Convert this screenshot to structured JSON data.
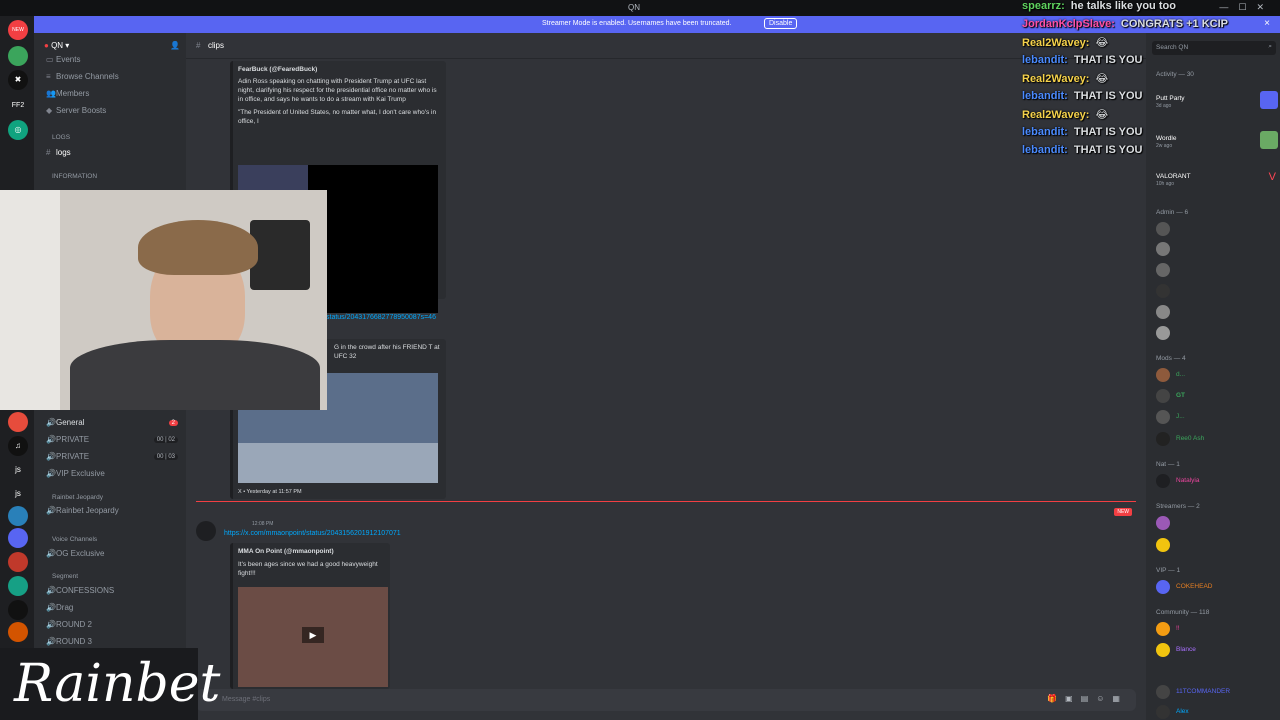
{
  "titlebar": {
    "title": "QN"
  },
  "banner": {
    "message": "Streamer Mode is enabled. Usernames have been truncated.",
    "button": "Disable",
    "close": "×"
  },
  "servers": [
    {
      "label": "NEW",
      "color": "#f23f43"
    },
    {
      "label": "FF2",
      "color": "#1e1f22"
    }
  ],
  "server": {
    "name": "QN"
  },
  "channels": {
    "top": [
      "Events",
      "Browse Channels",
      "Members",
      "Server Boosts"
    ],
    "cat_logs": "LOGS",
    "logs": "logs",
    "cat_info": "INFORMATION",
    "general": "General",
    "general_badge": "2",
    "private1": "PRIVATE",
    "private1_pill": "00 | 02",
    "private2": "PRIVATE",
    "private2_pill": "00 | 03",
    "vip": "VIP Exclusive",
    "cat_jeopardy": "Rainbet Jeopardy",
    "jeopardy": "Rainbet Jeopardy",
    "cat_voice": "Voice Channels",
    "og": "OG Exclusive",
    "cat_segment": "Segment",
    "confessions": "CONFESSIONS",
    "drag": "Drag",
    "round2": "ROUND 2",
    "round3": "ROUND 3"
  },
  "chat": {
    "channel": "clips",
    "card1_author": "FearBuck (@FearedBuck)",
    "card1_text": "Adin Ross speaking on chatting with President Trump at UFC last night, clarifying his respect for the presidential office no matter who is in office, and says he wants to do a stream with Kai Trump",
    "card1_quote": "\"The President of United States, no matter what, I don't care who's in office, I",
    "link1": "status/2043176682778950087s=46",
    "card2_text": "G in the crowd after his FRIEND T at UFC 32",
    "card2_footer": "X • Yesterday at 11:57 PM",
    "time2": "12:08 PM",
    "link2": "https://x.com/mmaonpoint/status/2043156201912107071",
    "card3_author": "MMA On Point (@mmaonpoint)",
    "card3_text": "It's been ages since we had a good heavyweight fight!!!",
    "new_tag": "NEW",
    "composer_placeholder": "Message #clips"
  },
  "members": {
    "search_placeholder": "Search QN",
    "activity_header": "Activity — 30",
    "activities": [
      "Putt Party",
      "Wordle",
      "VALORANT"
    ],
    "activity_times": [
      "3d ago",
      "2w ago",
      "10h ago"
    ],
    "admin_header": "Admin — 6",
    "mods_header": "Mods — 4",
    "mods": [
      "d...",
      "GT",
      "J...",
      "Ree0 Ash"
    ],
    "nat_header": "Nat — 1",
    "nat": "Natalyia",
    "streamers_header": "Streamers — 2",
    "vip_header": "VIP — 1",
    "vip": "COKEHEAD",
    "community_header": "Community — 118",
    "community": [
      "!!",
      "Blance",
      "11TCOMMANDER",
      "Alex"
    ]
  },
  "overlay": [
    {
      "user": "spearrz:",
      "msg": "he talks like you too",
      "color": "#5fd35f"
    },
    {
      "user": "JordanKclpSlave:",
      "msg": "CONGRATS +1 KCIP",
      "color": "#ff4fa3"
    },
    {
      "user": "Real2Wavey:",
      "msg": "😂",
      "color": "#f5d24b"
    },
    {
      "user": "lebandit:",
      "msg": "THAT IS YOU",
      "color": "#4b8bff"
    },
    {
      "user": "Real2Wavey:",
      "msg": "😂",
      "color": "#f5d24b"
    },
    {
      "user": "lebandit:",
      "msg": "THAT IS YOU",
      "color": "#4b8bff"
    },
    {
      "user": "Real2Wavey:",
      "msg": "😂",
      "color": "#f5d24b"
    },
    {
      "user": "lebandit:",
      "msg": "THAT IS YOU",
      "color": "#4b8bff"
    },
    {
      "user": "lebandit:",
      "msg": "THAT IS YOU",
      "color": "#4b8bff"
    }
  ],
  "sponsor": {
    "text": "Rainbet"
  }
}
